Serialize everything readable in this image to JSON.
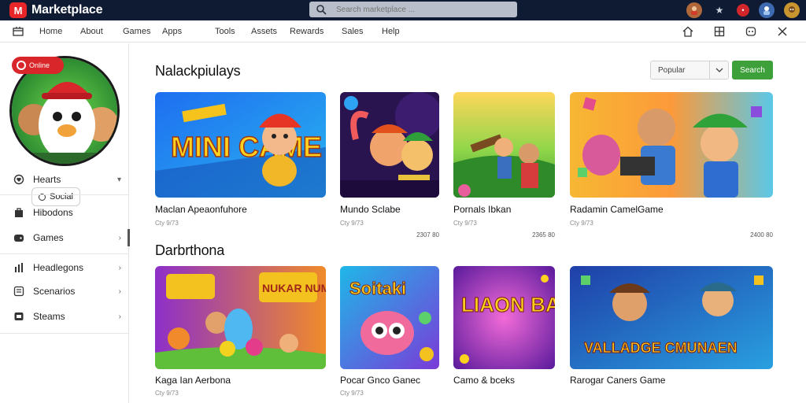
{
  "app": {
    "title": "Marketplace"
  },
  "search": {
    "placeholder": "Search marketplace ..."
  },
  "top_icons": [
    "avatar-icon",
    "star-icon",
    "notification-icon",
    "character-icon",
    "profile-icon"
  ],
  "notification_count": "•",
  "nav": {
    "items": [
      "Home",
      "About",
      "Games",
      "Apps",
      "Tools",
      "Assets",
      "Rewards",
      "Sales",
      "Help"
    ]
  },
  "sidebar": {
    "profile_pill": "Online",
    "profile_label": "Social",
    "items": [
      {
        "label": "Hearts",
        "icon": "heart-icon"
      },
      {
        "label": "Hibodons",
        "icon": "bag-icon"
      },
      {
        "label": "Games",
        "icon": "gamepad-icon"
      },
      {
        "label": "Headlegons",
        "icon": "bar-chart-icon"
      },
      {
        "label": "Scenarios",
        "icon": "list-icon"
      },
      {
        "label": "Steams",
        "icon": "folder-icon"
      }
    ]
  },
  "main": {
    "section1_title": "Nalackpiulays",
    "section2_title": "Darbrthona",
    "sort": {
      "value": "Popular"
    },
    "go_label": "Search",
    "row1": [
      {
        "title": "Maclan Apeaonfuhore",
        "meta": "Cty 9/73",
        "price": "",
        "art": "MINI CAME"
      },
      {
        "title": "Mundo Sclabe",
        "meta": "Cty 9/73",
        "price": "2307 80",
        "art": ""
      },
      {
        "title": "Pornals Ibkan",
        "meta": "Cty 9/73",
        "price": "2365 80",
        "art": ""
      },
      {
        "title": "Radamin CamelGame",
        "meta": "Cty 9/73",
        "price": "2400 80",
        "art": ""
      }
    ],
    "row2": [
      {
        "title": "Kaga Ian Aerbona",
        "meta": "Cty 9/73",
        "price": "",
        "art": "NUKAR NUMBS"
      },
      {
        "title": "Pocar Gnco Ganec",
        "meta": "Cty 9/73",
        "price": "",
        "art": "Soitaki"
      },
      {
        "title": "Camo & bceks",
        "meta": "",
        "price": "",
        "art": "LIAON BAINC!"
      },
      {
        "title": "Rarogar Caners Game",
        "meta": "",
        "price": "",
        "art": "VALLADGE CMUNAEN"
      }
    ]
  },
  "colors": {
    "topbar": "#0f1b33",
    "brand_red": "#e8262a",
    "accent_green": "#3ea03a"
  }
}
